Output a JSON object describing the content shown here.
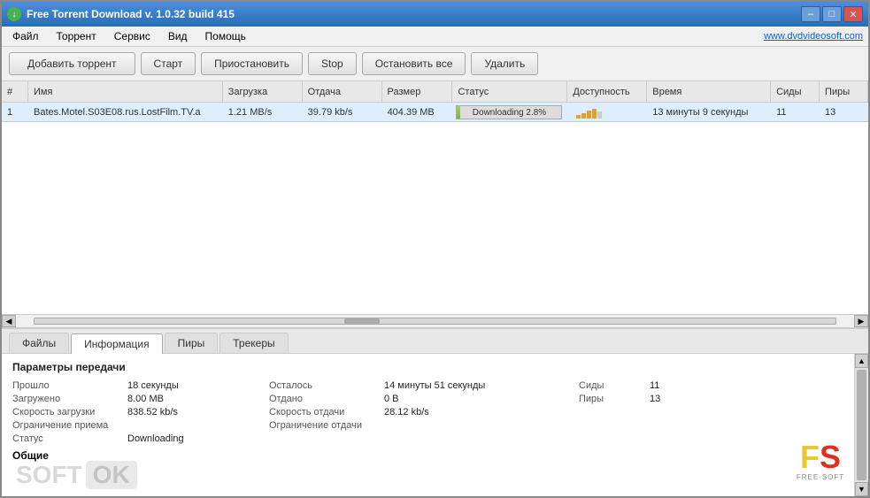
{
  "window": {
    "title": "Free Torrent Download v. 1.0.32 build 415",
    "icon": "↓"
  },
  "titlebar": {
    "minimize_label": "–",
    "maximize_label": "□",
    "close_label": "✕"
  },
  "menu": {
    "items": [
      "Файл",
      "Торрент",
      "Сервис",
      "Вид",
      "Помощь"
    ],
    "link": "www.dvdvideosoft.com"
  },
  "toolbar": {
    "add_label": "Добавить торрент",
    "start_label": "Старт",
    "pause_label": "Приостановить",
    "stop_label": "Stop",
    "stop_all_label": "Остановить все",
    "delete_label": "Удалить"
  },
  "table": {
    "headers": [
      "#",
      "Имя",
      "Загрузка",
      "Отдача",
      "Размер",
      "Статус",
      "Доступность",
      "Время",
      "Сиды",
      "Пиры"
    ],
    "rows": [
      {
        "num": "1",
        "name": "Bates.Motel.S03E08.rus.LostFilm.TV.a",
        "download": "1.21 MB/s",
        "upload": "39.79 kb/s",
        "size": "404.39 MB",
        "status": "Downloading 2.8%",
        "progress": 2.8,
        "availability": "bars",
        "time": "13 минуты 9 секунды",
        "seeds": "11",
        "peers": "13"
      }
    ]
  },
  "tabs": {
    "items": [
      "Файлы",
      "Информация",
      "Пиры",
      "Трекеры"
    ],
    "active": 1
  },
  "info_section": {
    "title": "Параметры передачи",
    "fields": [
      {
        "label": "Прошло",
        "value": "18 секунды"
      },
      {
        "label": "Осталось",
        "value": "14 минуты 51 секунды"
      },
      {
        "label": "Сиды",
        "value": "11"
      },
      {
        "label": "Загружено",
        "value": "8.00 MB"
      },
      {
        "label": "Отдано",
        "value": "0 B"
      },
      {
        "label": "Пиры",
        "value": "13"
      },
      {
        "label": "Скорость загрузки",
        "value": "838.52 kb/s"
      },
      {
        "label": "Скорость отдачи",
        "value": "28.12 kb/s"
      },
      {
        "label": "",
        "value": ""
      },
      {
        "label": "Ограничение приема",
        "value": ""
      },
      {
        "label": "Ограничение отдачи",
        "value": ""
      },
      {
        "label": "",
        "value": ""
      },
      {
        "label": "Статус",
        "value": "Downloading"
      },
      {
        "label": "",
        "value": ""
      },
      {
        "label": "",
        "value": ""
      }
    ]
  },
  "bottom_section": {
    "title": "Общие"
  },
  "watermark": {
    "soft": "SOFT",
    "ok": "OK"
  },
  "logo": {
    "f": "F",
    "s": "S",
    "text": "FREE-SOFT"
  }
}
